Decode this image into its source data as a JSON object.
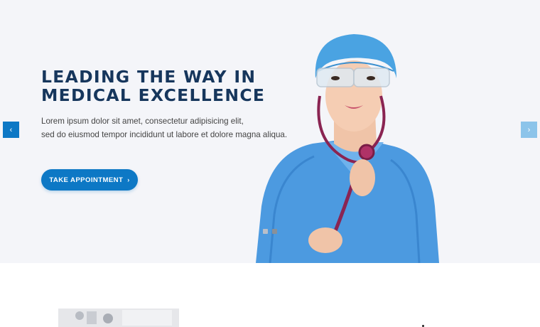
{
  "hero": {
    "title_line1": "LEADING THE WAY IN",
    "title_line2": "MEDICAL EXCELLENCE",
    "text_line1": "Lorem ipsum dolor sit amet, consectetur adipisicing elit,",
    "text_line2": "sed do eiusmod tempor incididunt ut labore et dolore magna aliqua.",
    "cta_label": "TAKE APPOINTMENT",
    "cta_icon": "chevron-right-icon",
    "prev_icon": "chevron-left-icon",
    "next_icon": "chevron-right-icon",
    "slide_count": 2,
    "active_slide": 2
  },
  "colors": {
    "title": "#16365c",
    "accent": "#0d78c5",
    "accent_light": "#8cc4ea",
    "hero_bg": "#f4f5f9"
  }
}
